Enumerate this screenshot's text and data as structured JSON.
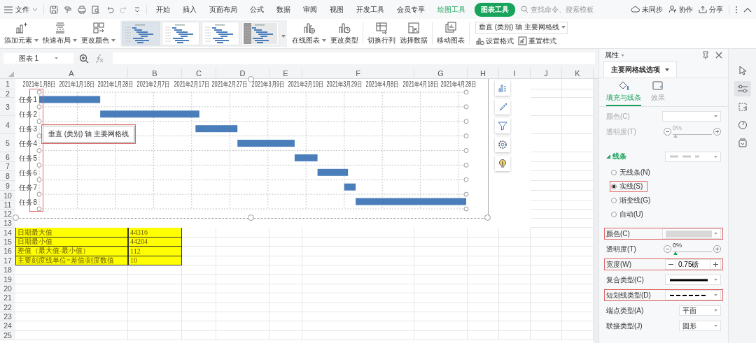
{
  "menu_bar": {
    "file": "文件",
    "tabs": [
      {
        "label": "开始",
        "kind": "standard",
        "selected": false
      },
      {
        "label": "插入",
        "kind": "standard",
        "selected": false
      },
      {
        "label": "页面布局",
        "kind": "standard",
        "selected": false
      },
      {
        "label": "公式",
        "kind": "standard",
        "selected": false
      },
      {
        "label": "数据",
        "kind": "standard",
        "selected": false
      },
      {
        "label": "审阅",
        "kind": "standard",
        "selected": false
      },
      {
        "label": "视图",
        "kind": "standard",
        "selected": false
      },
      {
        "label": "开发工具",
        "kind": "standard",
        "selected": false
      },
      {
        "label": "会员专享",
        "kind": "standard",
        "selected": false
      },
      {
        "label": "绘图工具",
        "kind": "contextual",
        "selected": false
      },
      {
        "label": "图表工具",
        "kind": "contextual",
        "selected": true
      }
    ],
    "search_placeholder": "查找命令、搜索模板",
    "actions": [
      "未同步",
      "协作",
      "分享"
    ]
  },
  "ribbon": {
    "buttons": [
      {
        "label": "添加元素",
        "dropdown": true
      },
      {
        "label": "快速布局",
        "dropdown": true
      },
      {
        "label": "更改颜色",
        "dropdown": true
      }
    ],
    "styles": [
      {
        "selected": true
      },
      {
        "selected": false
      },
      {
        "selected": false
      },
      {
        "selected": false
      }
    ],
    "chart_buttons": [
      {
        "label": "在线图表",
        "dropdown": true
      },
      {
        "label": "更改类型",
        "dropdown": false
      }
    ],
    "data_buttons": [
      "切换行列",
      "选择数据"
    ],
    "move_button": "移动图表",
    "element_select": "垂直 (类别) 轴 主要网格线",
    "format_buttons": [
      "设置格式",
      "重置样式"
    ]
  },
  "formula_bar": {
    "name_box": "图表 1"
  },
  "sheet": {
    "columns": [
      "A",
      "B",
      "C",
      "D",
      "E",
      "F",
      "G",
      "H",
      "I",
      "J",
      "K"
    ],
    "rows": [
      "1",
      "2",
      "3",
      "4",
      "5",
      "6",
      "7",
      "8",
      "9",
      "10",
      "11",
      "12",
      "13",
      "14",
      "15",
      "16",
      "17",
      "18",
      "19",
      "20",
      "21",
      "22",
      "23",
      "24",
      "25"
    ],
    "table": [
      {
        "label": "日期最大值",
        "value": "44316"
      },
      {
        "label": "日期最小值",
        "value": "44204"
      },
      {
        "label": "差值（最大值-最小值）",
        "value": "112"
      },
      {
        "label": "主要刻度线单位=差值/刻度数值",
        "value": "10"
      }
    ]
  },
  "chart": {
    "axis_highlighted": true,
    "tooltip": {
      "text": "垂直 (类别) 轴 主要网格线",
      "highlighted": true
    },
    "x_labels": [
      "2021年1月8日",
      "2021年1月18日",
      "2021年1月28日",
      "2021年2月7日",
      "2021年2月17日",
      "2021年2月27日",
      "2021年3月9日",
      "2021年3月19日",
      "2021年3月29日",
      "2021年4月8日",
      "2021年4月18日",
      "2021年4月28日"
    ],
    "categories": [
      "任务1",
      "任务2",
      "任务3",
      "任务4",
      "任务5",
      "任务6",
      "任务7",
      "任务8"
    ]
  },
  "panel": {
    "title": "属性",
    "section_tab": "主要网格线选项",
    "tabs": [
      {
        "label": "填充与线条",
        "selected": true
      },
      {
        "label": "效果",
        "selected": false
      }
    ],
    "fill": {
      "disabled": true,
      "rows": [
        {
          "kind": "color",
          "label": "颜色(C)",
          "highlighted": false
        },
        {
          "kind": "slider",
          "label": "透明度(T)",
          "reading": "0%",
          "level": 0,
          "highlighted": false
        }
      ]
    },
    "line": {
      "title": "线条",
      "expanded": true,
      "options": [
        {
          "label": "无线条(N)",
          "selected": false,
          "highlighted": false
        },
        {
          "label": "实线(S)",
          "selected": true,
          "highlighted": true
        },
        {
          "label": "渐变线(G)",
          "selected": false,
          "highlighted": false
        },
        {
          "label": "自动(U)",
          "selected": false,
          "highlighted": false
        }
      ],
      "rows": [
        {
          "kind": "color",
          "label": "颜色(C)",
          "color": "#d9d9d9",
          "highlighted": true
        },
        {
          "kind": "slider",
          "label": "透明度(T)",
          "reading": "0%",
          "level": 0,
          "highlighted": false
        },
        {
          "kind": "stepper",
          "label": "宽度(W)",
          "value": "0.75磅",
          "highlighted": true
        },
        {
          "kind": "line",
          "label": "复合类型(C)",
          "dashed": false,
          "highlighted": false
        },
        {
          "kind": "line",
          "label": "短划线类型(D)",
          "dashed": true,
          "highlighted": true
        },
        {
          "kind": "select",
          "label": "端点类型(A)",
          "value": "平面",
          "highlighted": false
        },
        {
          "kind": "select",
          "label": "联接类型(J)",
          "value": "圆形",
          "highlighted": false
        }
      ]
    }
  },
  "tool_strip": [
    {
      "selected": false
    },
    {
      "selected": true
    },
    {
      "selected": false
    },
    {
      "selected": false
    },
    {
      "selected": false
    }
  ]
}
